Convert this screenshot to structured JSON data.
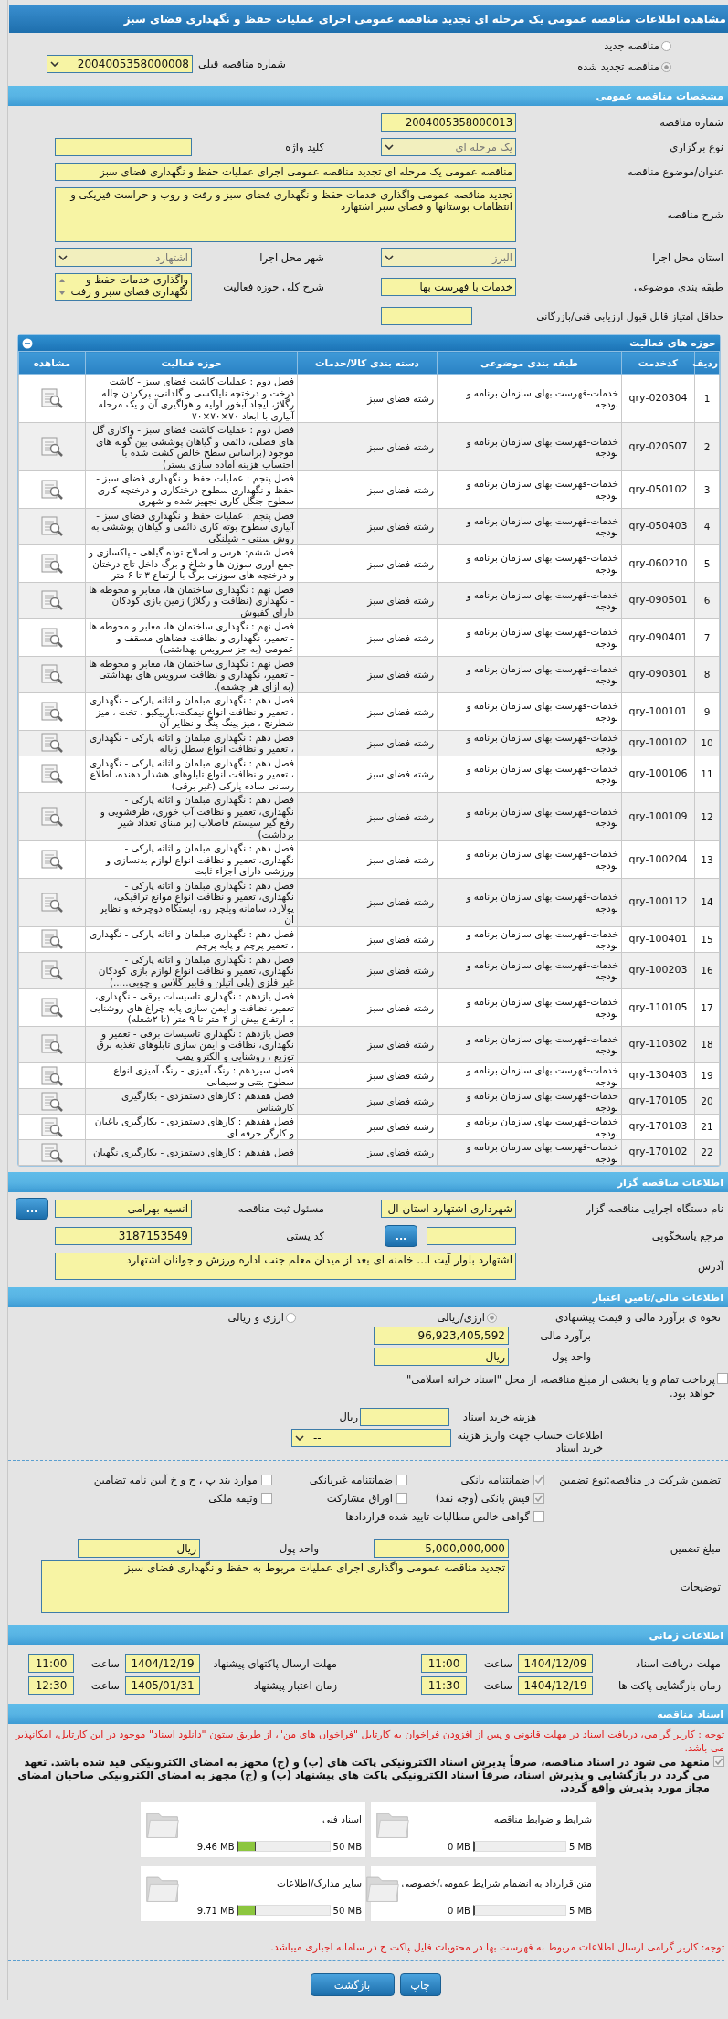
{
  "page_title": "مشاهده اطلاعات مناقصه عمومی یک مرحله ای تجدید مناقصه عمومی اجرای عملیات حفظ و نگهداری فضای سبز",
  "tender_type": [
    {
      "label": "مناقصه جدید",
      "selected": false
    },
    {
      "label": "مناقصه تجدید شده",
      "selected": true
    }
  ],
  "previous_tender": {
    "label": "شماره مناقصه قبلی",
    "value": "2004005358000008",
    "disabled": false
  },
  "general": {
    "title": "مشخصات مناقصه عمومی",
    "rows": [
      [
        {
          "label": "شماره مناقصه",
          "value": "2004005358000013",
          "kind": "text"
        }
      ],
      [
        {
          "label": "نوع برگزاری",
          "value": "یک مرحله ای",
          "kind": "select",
          "disabled": true
        },
        {
          "label": "کلید واژه",
          "kind": "text"
        }
      ],
      [
        {
          "label": "عنوان/موضوع مناقصه",
          "value": "مناقصه عمومی یک مرحله ای تجدید مناقصه عمومی اجرای عملیات حفظ و نگهداری فضای سبز",
          "kind": "wide"
        }
      ],
      [
        {
          "label": "شرح مناقصه",
          "value": "تجدید مناقصه عمومی واگذاری خدمات حفظ و نگهداری فضای سبز و رفت و روب و حراست فیزیکی و انتظامات بوستانها و فضای سبز اشتهارد",
          "kind": "textarea"
        }
      ],
      [
        {
          "label": "استان محل اجرا",
          "value": "البرز",
          "kind": "select",
          "disabled": true
        },
        {
          "label": "شهر محل اجرا",
          "value": "اشتهارد",
          "kind": "select",
          "disabled": true
        }
      ],
      [
        {
          "label": "طبقه بندی موضوعی",
          "value": "خدمات با فهرست بها",
          "kind": "text"
        },
        {
          "label": "شرح کلی حوزه فعالیت",
          "value": "واگذاری خدمات حفظ و نگهداری فضای سبز و رفت",
          "kind": "list"
        }
      ],
      [
        {
          "label": "حداقل امتیاز قابل قبول ارزیابی فنی/بازرگانی",
          "kind": "short"
        }
      ]
    ]
  },
  "activities": {
    "title": "حوزه های فعالیت",
    "columns": [
      "ردیف",
      "کدخدمت",
      "طبقه بندی موضوعی",
      "دسته بندی کالا/خدمات",
      "حوزه فعالیت",
      "مشاهده"
    ],
    "rows": [
      {
        "index": "1",
        "code": "qry-020304",
        "category": "خدمات-فهرست بهای سازمان برنامه و بودجه",
        "group": "رشته فضای سبز",
        "activity": "فصل دوم : عملیات کاشت فضای سبز - کاشت درخت و درختچه نایلکسی و گلدانی، پرکردن چاله رگلاژ، ایجاد آبخور اولیه و هواگیری آن و یک مرحله آبیاری با ابعاد ۷۰×۷۰×۷۰"
      },
      {
        "index": "2",
        "code": "qry-020507",
        "category": "خدمات-فهرست بهای سازمان برنامه و بودجه",
        "group": "رشته فضای سبز",
        "activity": "فصل دوم : عملیات کاشت فضای سبز - واکاری گل های فصلی، دائمی و گیاهان پوششی بین گونه های موجود (براساس سطح خالص کشت شده با احتساب هزینه آماده سازی بستر)"
      },
      {
        "index": "3",
        "code": "qry-050102",
        "category": "خدمات-فهرست بهای سازمان برنامه و بودجه",
        "group": "رشته فضای سبز",
        "activity": "فصل پنجم : عملیات حفظ و نگهداری فضای سبز - حفظ و نگهداری سطوح درختکاری و درختچه کاری سطوح جنگل کاری تجهیز شده و شهری"
      },
      {
        "index": "4",
        "code": "qry-050403",
        "category": "خدمات-فهرست بهای سازمان برنامه و بودجه",
        "group": "رشته فضای سبز",
        "activity": "فصل پنجم : عملیات حفظ و نگهداری فضای سبز - آبیاری سطوح بوته کاری دائمی و گیاهان پوششی به روش سنتی - شیلنگی"
      },
      {
        "index": "5",
        "code": "qry-060210",
        "category": "خدمات-فهرست بهای سازمان برنامه و بودجه",
        "group": "رشته فضای سبز",
        "activity": "فصل ششم: هرس و اصلاح توده گیاهی - پاکسازی و جمع اوری سوزن ها و شاخ و برگ داخل تاج درختان و درختچه های سوزنی برگ با ارتفاع ۳ تا ۶ متر"
      },
      {
        "index": "6",
        "code": "qry-090501",
        "category": "خدمات-فهرست بهای سازمان برنامه و بودجه",
        "group": "رشته فضای سبز",
        "activity": "فصل نهم : نگهداری ساختمان ها، معابر و محوطه ها - نگهداری (نظافت و رگلاژ) زمین بازی کودکان دارای کفپوش"
      },
      {
        "index": "7",
        "code": "qry-090401",
        "category": "خدمات-فهرست بهای سازمان برنامه و بودجه",
        "group": "رشته فضای سبز",
        "activity": "فصل نهم : نگهداری ساختمان ها، معابر و محوطه ها - تعمیر، نگهداری و نظافت فضاهای مسقف و عمومی (به جز سرویس بهداشتی)"
      },
      {
        "index": "8",
        "code": "qry-090301",
        "category": "خدمات-فهرست بهای سازمان برنامه و بودجه",
        "group": "رشته فضای سبز",
        "activity": "فصل نهم : نگهداری ساختمان ها، معابر و محوطه ها - تعمیر، نگهداری و نظافت سرویس های بهداشتی (به ازای هر چشمه)."
      },
      {
        "index": "9",
        "code": "qry-100101",
        "category": "خدمات-فهرست بهای سازمان برنامه و بودجه",
        "group": "رشته فضای سبز",
        "activity": "فصل دهم : نگهداری مبلمان و اثاثه پارکی - نگهداری ، تعمیر و نظافت انواع نیمکت،باربیکیو ، تخت ، میز شطرنج ، میز پینگ پنگ و نظایر آن"
      },
      {
        "index": "10",
        "code": "qry-100102",
        "category": "خدمات-فهرست بهای سازمان برنامه و بودجه",
        "group": "رشته فضای سبز",
        "activity": "فصل دهم : نگهداری مبلمان و اثاثه پارکی - نگهداری ، تعمیر و نظافت انواع سطل زباله"
      },
      {
        "index": "11",
        "code": "qry-100106",
        "category": "خدمات-فهرست بهای سازمان برنامه و بودجه",
        "group": "رشته فضای سبز",
        "activity": "فصل دهم : نگهداری مبلمان و اثاثه پارکی - نگهداری ، تعمیر و نظافت انواع تابلوهای هشدار دهنده، اطلاع رسانی ساده پارکی (غیر برقی)"
      },
      {
        "index": "12",
        "code": "qry-100109",
        "category": "خدمات-فهرست بهای سازمان برنامه و بودجه",
        "group": "رشته فضای سبز",
        "activity": "فصل دهم : نگهداری مبلمان و اثاثه پارکی - نگهداری، تعمیر و نظافت آب خوری، ظرفشویی و رفع گیر سیستم فاضلاب (بر مبنای تعداد شیر برداشت)"
      },
      {
        "index": "13",
        "code": "qry-100204",
        "category": "خدمات-فهرست بهای سازمان برنامه و بودجه",
        "group": "رشته فضای سبز",
        "activity": "فصل دهم : نگهداری مبلمان و اثاثه پارکی - نگهداری، تعمیر و نظافت انواع لوازم بدنسازی و ورزشی دارای اجزاء ثابت"
      },
      {
        "index": "14",
        "code": "qry-100112",
        "category": "خدمات-فهرست بهای سازمان برنامه و بودجه",
        "group": "رشته فضای سبز",
        "activity": "فصل دهم : نگهداری مبلمان و اثاثه پارکی - نگهداری، تعمیر و نظافت انواع موانع ترافیکی، پولارد، سامانه ویلچر رو، ایستگاه دوچرخه و نظایر ان"
      },
      {
        "index": "15",
        "code": "qry-100401",
        "category": "خدمات-فهرست بهای سازمان برنامه و بودجه",
        "group": "رشته فضای سبز",
        "activity": "فصل دهم : نگهداری مبلمان و اثاثه پارکی - نگهداری ، تعمیر پرچم و پایه پرچم"
      },
      {
        "index": "16",
        "code": "qry-100203",
        "category": "خدمات-فهرست بهای سازمان برنامه و بودجه",
        "group": "رشته فضای سبز",
        "activity": "فصل دهم : نگهداری مبلمان و اثاثه پارکی - نگهداری، تعمیر و نظافت انواع لوازم بازی کودکان غیر فلزی (پلی اتیلن و فایبر گلاس و چوبی.....)"
      },
      {
        "index": "17",
        "code": "qry-110105",
        "category": "خدمات-فهرست بهای سازمان برنامه و بودجه",
        "group": "رشته فضای سبز",
        "activity": "فصل یازدهم : نگهداری تاسیسات برقی - نگهداری، تعمیر، نظافت و ایمن سازی پایه چراغ های روشنایی با ارتفاع بیش از ۴ متر تا ۹ متر (تا ۲شعله)"
      },
      {
        "index": "18",
        "code": "qry-110302",
        "category": "خدمات-فهرست بهای سازمان برنامه و بودجه",
        "group": "رشته فضای سبز",
        "activity": "فصل یازدهم : نگهداری تاسیسات برقی - تعمیر و نگهداری، نظافت و ایمن سازی تابلوهای تغذیه برق توزیع ، روشنایی و الکترو پمپ"
      },
      {
        "index": "19",
        "code": "qry-130403",
        "category": "خدمات-فهرست بهای سازمان برنامه و بودجه",
        "group": "رشته فضای سبز",
        "activity": "فصل سیزدهم : رنگ آمیزی - رنگ آمیزی انواع سطوح بتنی و سیمانی"
      },
      {
        "index": "20",
        "code": "qry-170105",
        "category": "خدمات-فهرست بهای سازمان برنامه و بودجه",
        "group": "رشته فضای سبز",
        "activity": "فصل هفدهم : کارهای دستمزدی - بکارگیری کارشناس"
      },
      {
        "index": "21",
        "code": "qry-170103",
        "category": "خدمات-فهرست بهای سازمان برنامه و بودجه",
        "group": "رشته فضای سبز",
        "activity": "فصل هفدهم : کارهای دستمزدی - بکارگیری باغبان و کارگر حرفه ای"
      },
      {
        "index": "22",
        "code": "qry-170102",
        "category": "خدمات-فهرست بهای سازمان برنامه و بودجه",
        "group": "رشته فضای سبز",
        "activity": "فصل هفدهم : کارهای دستمزدی - بکارگیری نگهبان"
      }
    ]
  },
  "organizer": {
    "title": "اطلاعات مناقصه گزار",
    "agency": {
      "label": "نام دستگاه اجرایی مناقصه گزار",
      "value": "شهرداری اشتهارد استان ال"
    },
    "registrar": {
      "label": "مسئول ثبت مناقصه",
      "value": "انسیه بهرامی",
      "button": "..."
    },
    "reference": {
      "label": "مرجع پاسخگویی",
      "button": "..."
    },
    "postal": {
      "label": "کد پستی",
      "value": "3187153549"
    },
    "address": {
      "label": "آدرس",
      "value": "اشتهارد بلوار آیت ا... خامنه ای بعد از میدان معلم جنب اداره ورزش و جوانان اشتهارد"
    }
  },
  "finance": {
    "title": "اطلاعات مالی/تامین اعتبار",
    "method": {
      "label": "نحوه ی برآورد مالی و قیمت پیشنهادی",
      "options": [
        {
          "label": "ارزی/ریالی",
          "selected": true
        },
        {
          "label": "ارزی و ریالی",
          "selected": false
        }
      ]
    },
    "estimate": {
      "label": "برآورد مالی",
      "value": "96,923,405,592"
    },
    "currency": {
      "label": "واحد پول",
      "value": "ریال"
    },
    "treasury": {
      "label": "پرداخت تمام و یا بخشی از مبلغ مناقصه، از محل \"اسناد خزانه اسلامی\" خواهد بود.",
      "checked": false
    },
    "doc_fee": {
      "label": "هزینه خرید اسناد",
      "unit": "ریال"
    },
    "account": {
      "label": "اطلاعات حساب جهت واریز هزینه خرید اسناد",
      "value": "--"
    },
    "guarantee": {
      "label": "تضمین شرکت در مناقصه:",
      "type_label": "نوع تضمین",
      "options": [
        {
          "label": "ضمانتنامه بانکی",
          "checked": true
        },
        {
          "label": "ضمانتنامه غیربانکی",
          "checked": false
        },
        {
          "label": "موارد بند پ ، ح و خ آیین نامه تضامین",
          "checked": false
        },
        {
          "label": "فیش بانکی (وجه نقد)",
          "checked": true
        },
        {
          "label": "اوراق مشارکت",
          "checked": false
        },
        {
          "label": "وثیقه ملکی",
          "checked": false
        },
        {
          "label": "گواهی خالص مطالبات تایید شده قراردادها",
          "checked": false
        }
      ]
    },
    "amount": {
      "label": "مبلغ تضمین",
      "value": "5,000,000,000"
    },
    "amount_currency": {
      "label": "واحد پول",
      "value": "ریال"
    },
    "notes": {
      "label": "توضیحات",
      "value": "تجدید مناقصه عمومی واگذاری اجرای عملیات مربوط به حفظ و نگهداری فضای سبز"
    }
  },
  "timing": {
    "title": "اطلاعات زمانی",
    "items": [
      {
        "label": "مهلت دریافت اسناد",
        "date": "1404/12/09",
        "hour_label": "ساعت",
        "time": "11:00"
      },
      {
        "label": "مهلت ارسال پاکتهای پیشنهاد",
        "date": "1404/12/19",
        "hour_label": "ساعت",
        "time": "11:00"
      },
      {
        "label": "زمان بازگشایی پاکت ها",
        "date": "1404/12/19",
        "hour_label": "ساعت",
        "time": "11:30"
      },
      {
        "label": "زمان اعتبار پیشنهاد",
        "date": "1405/01/31",
        "hour_label": "ساعت",
        "time": "12:30"
      }
    ]
  },
  "documents": {
    "title": "اسناد مناقصه",
    "notice": "توجه : کاربر گرامی، دریافت اسناد در مهلت قانونی و پس از افزودن فراخوان به کارتابل \"فراخوان های من\"، از طریق ستون \"دانلود اسناد\" موجود در این کارتابل، امکانپذیر می باشد.",
    "commitment": {
      "text": "متعهد می شود در اسناد مناقصه، صرفاً پذیرش اسناد الکترونیکی پاکت های (ب) و (ج) مجهز به امضای الکترونیکی قید شده باشد. تعهد می گردد در بازگشایی و پذیرش اسناد، صرفاً اسناد الکترونیکی پاکت های پیشنهاد (ب) و (ج) مجهز به امضای الکترونیکی صاحبان امضای مجاز مورد پذیرش واقع گردد.",
      "checked": true
    },
    "files": [
      {
        "title": "شرایط و ضوابط مناقصه",
        "max": "5 MB",
        "used": "0 MB",
        "level": 0
      },
      {
        "title": "اسناد فنی",
        "max": "50 MB",
        "used": "9.46 MB",
        "level": 0.19
      },
      {
        "title": "متن قرارداد به انضمام شرایط عمومی/خصوصی",
        "max": "5 MB",
        "used": "0 MB",
        "level": 0
      },
      {
        "title": "سایر مدارک/اطلاعات",
        "max": "50 MB",
        "used": "9.71 MB",
        "level": 0.19
      }
    ],
    "warning": "توجه: کاربر گرامی ارسال اطلاعات مربوط به فهرست بها در محتویات فایل پاکت ج در سامانه اجباری میباشد."
  },
  "buttons": [
    "چاپ",
    "بازگشت"
  ]
}
